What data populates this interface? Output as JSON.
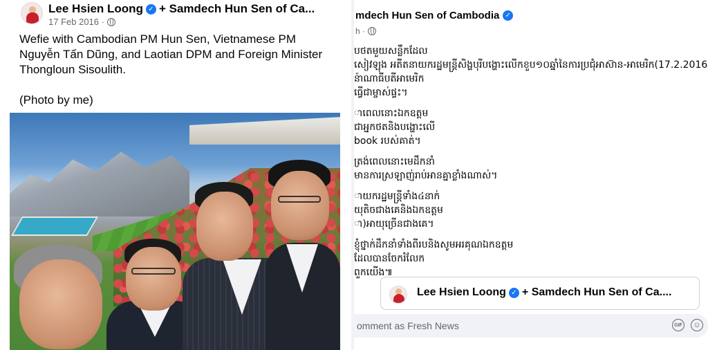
{
  "left_post": {
    "author": "Lee Hsien Loong",
    "coauthor": "+ Samdech Hun Sen of Ca...",
    "date": "17 Feb 2016 ·",
    "caption_line1": "Wefie with Cambodian PM Hun Sen, Vietnamese PM Nguyễn Tấn Dũng, and Laotian DPM and Foreign Minister Thongloun Sisoulith.",
    "caption_line2": "(Photo by me)",
    "photo_alt": "wefie-photo"
  },
  "right_post": {
    "author": "mdech Hun Sen of Cambodia",
    "meta": "h ·",
    "body_lines": [
      "បថតមួយសន្លឹកដែល",
      "សៀវឡុង អតីតនាយករដ្ឋមន្ត្រីសិង្ហបុរីបង្ហោះលើកខួប១០ឆ្នាំនៃការប្រជុំអាស៊ាន-អាមេរិក(17.2.2016",
      "ន៉ាណាធីបតីអាមេរិក",
      "ធ្វើជាម្ចាស់ផ្ទះ។",
      "",
      "ាពេលនោះឯកឧត្តម",
      "ជាអ្នកថតនិងបង្ហោះលើ",
      "book របស់គាត់។",
      "",
      "ត្រង់ពេលនោះមេដឹកនាំ",
      "មានការស្រឡាញ់រាប់អានគ្នាខ្លាំងណាស់។",
      "",
      "ាយករដ្ឋមន្ត្រីទាំង៤នាក់",
      "យុតិចជាងគេនិងឯកឧត្តម",
      "ា)អាយុច្រើនជាងគេ។",
      "",
      "ខ្ញុំថ្នាក់ដឹកនាំទាំងពីរបនិងសូមអរគុណឯកឧត្តម",
      "ដែលបានចែករំលែក",
      "ពួកយើង៕"
    ],
    "shared": {
      "author": "Lee Hsien Loong",
      "coauthor": "+ Samdech Hun Sen of Ca...."
    },
    "comment_placeholder": "omment as Fresh News"
  },
  "icons": {
    "verified": "verified-badge-icon",
    "globe": "globe-icon",
    "gif": "gif-icon",
    "emoji": "emoji-icon"
  },
  "colors": {
    "verified": "#1877f2",
    "meta_text": "#65676b",
    "comment_bg": "#f0f2f5"
  }
}
